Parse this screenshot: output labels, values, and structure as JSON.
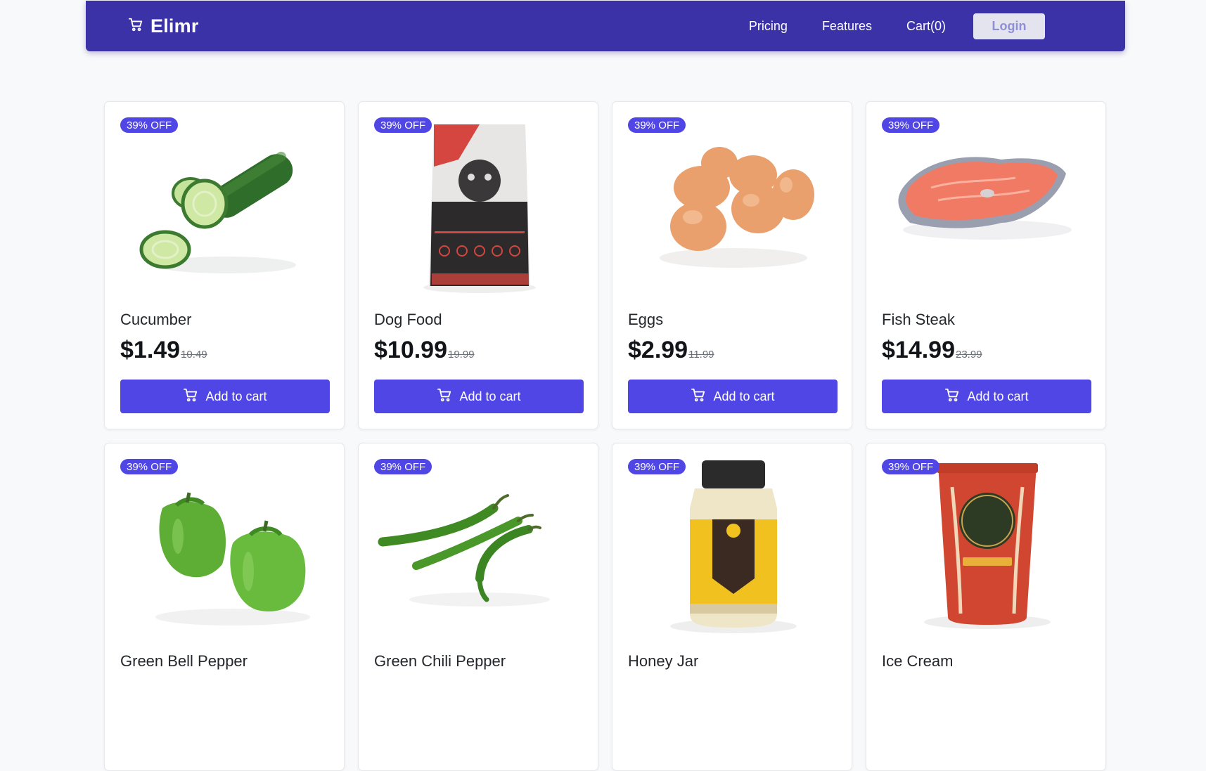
{
  "nav": {
    "brand": "Elimr",
    "links": [
      "Pricing",
      "Features",
      "Cart(0)"
    ],
    "login": "Login",
    "icon": "cart-icon"
  },
  "colors": {
    "nav_bg": "#3b32a8",
    "accent": "#4f46e5",
    "page_bg": "#f8f9fb"
  },
  "products": [
    {
      "badge": "39% OFF",
      "name": "Cucumber",
      "price": "$1.49",
      "old_price": "10.49",
      "button": "Add to cart",
      "image": "cucumber-image"
    },
    {
      "badge": "39% OFF",
      "name": "Dog Food",
      "price": "$10.99",
      "old_price": "19.99",
      "button": "Add to cart",
      "image": "dog-food-bag-image"
    },
    {
      "badge": "39% OFF",
      "name": "Eggs",
      "price": "$2.99",
      "old_price": "11.99",
      "button": "Add to cart",
      "image": "eggs-image"
    },
    {
      "badge": "39% OFF",
      "name": "Fish Steak",
      "price": "$14.99",
      "old_price": "23.99",
      "button": "Add to cart",
      "image": "fish-steak-image"
    },
    {
      "badge": "39% OFF",
      "name": "Green Bell Pepper",
      "image": "green-bell-pepper-image"
    },
    {
      "badge": "39% OFF",
      "name": "Green Chili Pepper",
      "image": "green-chili-pepper-image"
    },
    {
      "badge": "39% OFF",
      "name": "Honey Jar",
      "image": "honey-jar-image"
    },
    {
      "badge": "39% OFF",
      "name": "Ice Cream",
      "image": "ice-cream-tub-image"
    }
  ]
}
